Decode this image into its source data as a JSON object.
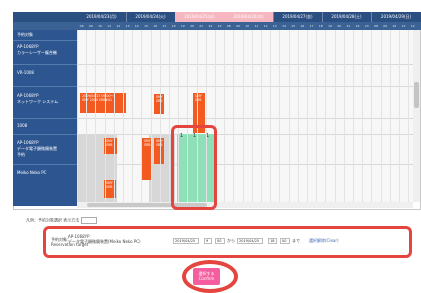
{
  "header": {
    "days": [
      {
        "label": "2019/04/23(月)",
        "highlight": false
      },
      {
        "label": "2019/04/24(火)",
        "highlight": false
      },
      {
        "label": "2019/04/25(水)",
        "highlight": true
      },
      {
        "label": "2019/04/26(木)",
        "highlight": false
      },
      {
        "label": "2019/04/27(金)",
        "highlight": false
      },
      {
        "label": "2019/04/28(土)",
        "highlight": false
      },
      {
        "label": "2019/04/29(日)",
        "highlight": false
      }
    ],
    "hours": [
      "08",
      "09",
      "10",
      "11",
      "12",
      "13",
      "14",
      "15",
      "16",
      "17",
      "18",
      "19",
      "20",
      "21",
      "22",
      "23",
      "08",
      "09",
      "10",
      "11",
      "12",
      "13",
      "14",
      "15",
      "16",
      "17",
      "18",
      "19",
      "20",
      "21",
      "22",
      "23",
      "08",
      "09",
      "10",
      "11",
      "12"
    ]
  },
  "sidebar": {
    "items": [
      {
        "label": "予約対象"
      },
      {
        "label": "AP-1068YP\nカラーレーザー複合機"
      },
      {
        "label": "VR-1008"
      },
      {
        "label": "AP-1068YP\nネットワーク システム"
      },
      {
        "label": "1008"
      },
      {
        "label": "AP-1068YP\nデータ電子顕微鏡装置\n予約"
      },
      {
        "label": "Meiko Neko PC"
      }
    ]
  },
  "bookings": [
    {
      "text": "2019/04/23 09:00～\nSMY 2019 SRB#01"
    },
    {
      "text": "SMY\nSRB"
    },
    {
      "text": "SMY\nSRB"
    },
    {
      "text": "SMY\nSRB"
    },
    {
      "text": "SMY\nSRB"
    },
    {
      "text": "SMY\nSRB"
    },
    {
      "text": "SMY\nSRB"
    }
  ],
  "selection_marks": [
    "1",
    "1",
    "1"
  ],
  "legend": {
    "label": "凡例：予約対象選択 表示方法"
  },
  "form": {
    "target_label": "予約対象：\nReservation target",
    "target_value": "AP-1068YP\nデータ電子顕微鏡装置(Meiko Neko PC)",
    "start_date": "2019/04/25",
    "start_hour": "9",
    "start_min": "00",
    "from_label": "から",
    "end_date": "2019/04/25",
    "end_hour": "18",
    "end_min": "00",
    "to_label": "まで",
    "clear_label": "選択解除(Clear)"
  },
  "confirm": {
    "label": "選択する\nConfirm"
  },
  "colors": {
    "navy": "#2b4f81",
    "booking": "#f25a1f",
    "selection": "#8fe0b8",
    "highlight": "#e4463f",
    "confirm": "#f45e9e"
  }
}
